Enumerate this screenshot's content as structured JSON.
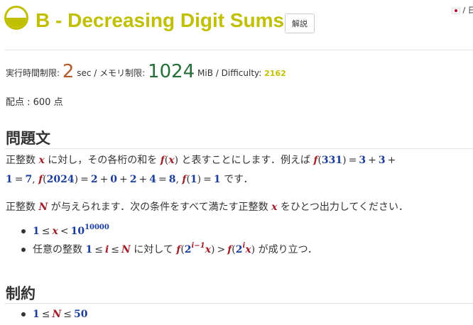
{
  "header": {
    "title": "B - Decreasing Digit Sums",
    "editorial_label": "解説",
    "lang_label": "/ 日"
  },
  "limits": {
    "time_label": "実行時間制限:",
    "time_value": "2",
    "time_unit": "sec / メモリ制限:",
    "memory_value": "1024",
    "memory_unit": "MiB / Difficulty:",
    "difficulty_value": "2162"
  },
  "score": {
    "text": "配点 : 600 点"
  },
  "sections": {
    "problem_title": "問題文",
    "constraints_title": "制約"
  },
  "problem": {
    "p1_a": "正整数",
    "p1_b": "に対し，その各桁の和を",
    "p1_c": "と表すことにします．例えば",
    "p1_d": "です．",
    "p2_a": "正整数",
    "p2_b": "が与えられます．次の条件をすべて満たす正整数",
    "p2_c": "をひとつ出力してください．",
    "item2_a": "任意の整数",
    "item2_b": "に対して",
    "item2_c": "が成り立つ．"
  },
  "math": {
    "x": "x",
    "f": "f",
    "N": "N",
    "i": "i",
    "n331": "331",
    "n3": "3",
    "n1": "1",
    "n7": "7",
    "n2024": "2024",
    "n2": "2",
    "n0": "0",
    "n4": "4",
    "n8": "8",
    "n10": "10",
    "n10000": "10000",
    "n50": "50",
    "sup_im1": "i−1",
    "eq": "=",
    "plus": "+",
    "le": "≤",
    "lt": "<",
    "gt": ">",
    "lp": "(",
    "rp": ")",
    "comma": ","
  },
  "colors": {
    "difficulty": "#c0c000",
    "time": "#b35b2c",
    "memory": "#266f3a",
    "variable": "#a0202c",
    "number": "#1a3d9a"
  }
}
